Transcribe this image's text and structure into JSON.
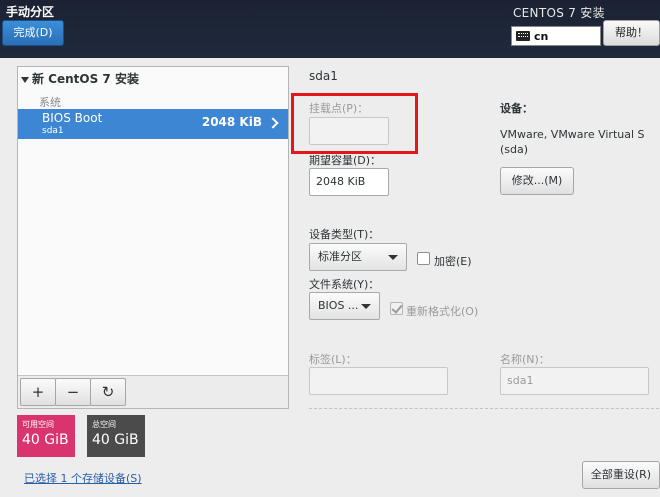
{
  "header": {
    "title": "手动分区",
    "done_label": "完成(D)",
    "product": "CENTOS 7 安装",
    "keyboard_layout": "cn",
    "help_label": "帮助！"
  },
  "left_panel": {
    "install_title": "新 CentOS 7 安装",
    "group_label": "系统",
    "partitions": [
      {
        "name": "BIOS Boot",
        "device": "sda1",
        "size": "2048 KiB",
        "selected": true
      }
    ],
    "toolbar": {
      "add": "+",
      "remove": "−",
      "refresh": "↻"
    }
  },
  "space": {
    "available_label": "可用空间",
    "available_value": "40 GiB",
    "total_label": "总空间",
    "total_value": "40 GiB"
  },
  "storage_link": "已选择 1 个存储设备(S)",
  "detail": {
    "title": "sda1",
    "mount_point_label": "挂载点(P)：",
    "mount_point_value": "",
    "capacity_label": "期望容量(D)：",
    "capacity_value": "2048 KiB",
    "device_label": "设备：",
    "device_value": "VMware, VMware Virtual S",
    "device_sub": "(sda)",
    "modify_label": "修改...(M)",
    "device_type_label": "设备类型(T)：",
    "device_type_value": "标准分区",
    "encrypt_label": "加密(E)",
    "encrypt_checked": false,
    "filesystem_label": "文件系统(Y)：",
    "filesystem_value": "BIOS ...",
    "reformat_label": "重新格式化(O)",
    "reformat_checked": true,
    "tag_label": "标签(L)：",
    "tag_value": "",
    "name_label": "名称(N)：",
    "name_value": "sda1",
    "reset_label": "全部重设(R)"
  },
  "colors": {
    "header_bg": "#1a2233",
    "accent_blue": "#3c86d3",
    "available_pink": "#d9346d",
    "total_gray": "#4b4b4b",
    "highlight_red": "#e4151b"
  }
}
